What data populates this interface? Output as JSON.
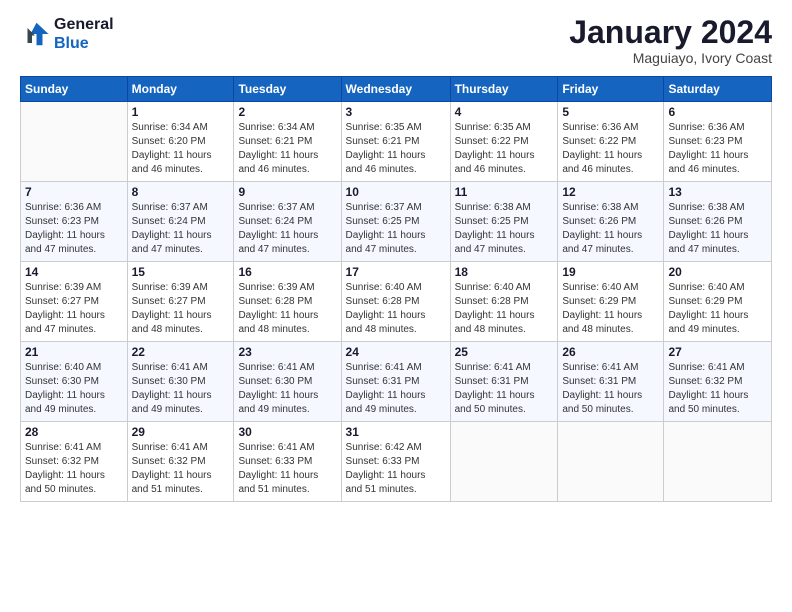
{
  "logo": {
    "line1": "General",
    "line2": "Blue"
  },
  "title": "January 2024",
  "subtitle": "Maguiayo, Ivory Coast",
  "days": [
    "Sunday",
    "Monday",
    "Tuesday",
    "Wednesday",
    "Thursday",
    "Friday",
    "Saturday"
  ],
  "weeks": [
    [
      {
        "day": "",
        "content": ""
      },
      {
        "day": "1",
        "content": "Sunrise: 6:34 AM\nSunset: 6:20 PM\nDaylight: 11 hours\nand 46 minutes."
      },
      {
        "day": "2",
        "content": "Sunrise: 6:34 AM\nSunset: 6:21 PM\nDaylight: 11 hours\nand 46 minutes."
      },
      {
        "day": "3",
        "content": "Sunrise: 6:35 AM\nSunset: 6:21 PM\nDaylight: 11 hours\nand 46 minutes."
      },
      {
        "day": "4",
        "content": "Sunrise: 6:35 AM\nSunset: 6:22 PM\nDaylight: 11 hours\nand 46 minutes."
      },
      {
        "day": "5",
        "content": "Sunrise: 6:36 AM\nSunset: 6:22 PM\nDaylight: 11 hours\nand 46 minutes."
      },
      {
        "day": "6",
        "content": "Sunrise: 6:36 AM\nSunset: 6:23 PM\nDaylight: 11 hours\nand 46 minutes."
      }
    ],
    [
      {
        "day": "7",
        "content": "Sunrise: 6:36 AM\nSunset: 6:23 PM\nDaylight: 11 hours\nand 47 minutes."
      },
      {
        "day": "8",
        "content": "Sunrise: 6:37 AM\nSunset: 6:24 PM\nDaylight: 11 hours\nand 47 minutes."
      },
      {
        "day": "9",
        "content": "Sunrise: 6:37 AM\nSunset: 6:24 PM\nDaylight: 11 hours\nand 47 minutes."
      },
      {
        "day": "10",
        "content": "Sunrise: 6:37 AM\nSunset: 6:25 PM\nDaylight: 11 hours\nand 47 minutes."
      },
      {
        "day": "11",
        "content": "Sunrise: 6:38 AM\nSunset: 6:25 PM\nDaylight: 11 hours\nand 47 minutes."
      },
      {
        "day": "12",
        "content": "Sunrise: 6:38 AM\nSunset: 6:26 PM\nDaylight: 11 hours\nand 47 minutes."
      },
      {
        "day": "13",
        "content": "Sunrise: 6:38 AM\nSunset: 6:26 PM\nDaylight: 11 hours\nand 47 minutes."
      }
    ],
    [
      {
        "day": "14",
        "content": "Sunrise: 6:39 AM\nSunset: 6:27 PM\nDaylight: 11 hours\nand 47 minutes."
      },
      {
        "day": "15",
        "content": "Sunrise: 6:39 AM\nSunset: 6:27 PM\nDaylight: 11 hours\nand 48 minutes."
      },
      {
        "day": "16",
        "content": "Sunrise: 6:39 AM\nSunset: 6:28 PM\nDaylight: 11 hours\nand 48 minutes."
      },
      {
        "day": "17",
        "content": "Sunrise: 6:40 AM\nSunset: 6:28 PM\nDaylight: 11 hours\nand 48 minutes."
      },
      {
        "day": "18",
        "content": "Sunrise: 6:40 AM\nSunset: 6:28 PM\nDaylight: 11 hours\nand 48 minutes."
      },
      {
        "day": "19",
        "content": "Sunrise: 6:40 AM\nSunset: 6:29 PM\nDaylight: 11 hours\nand 48 minutes."
      },
      {
        "day": "20",
        "content": "Sunrise: 6:40 AM\nSunset: 6:29 PM\nDaylight: 11 hours\nand 49 minutes."
      }
    ],
    [
      {
        "day": "21",
        "content": "Sunrise: 6:40 AM\nSunset: 6:30 PM\nDaylight: 11 hours\nand 49 minutes."
      },
      {
        "day": "22",
        "content": "Sunrise: 6:41 AM\nSunset: 6:30 PM\nDaylight: 11 hours\nand 49 minutes."
      },
      {
        "day": "23",
        "content": "Sunrise: 6:41 AM\nSunset: 6:30 PM\nDaylight: 11 hours\nand 49 minutes."
      },
      {
        "day": "24",
        "content": "Sunrise: 6:41 AM\nSunset: 6:31 PM\nDaylight: 11 hours\nand 49 minutes."
      },
      {
        "day": "25",
        "content": "Sunrise: 6:41 AM\nSunset: 6:31 PM\nDaylight: 11 hours\nand 50 minutes."
      },
      {
        "day": "26",
        "content": "Sunrise: 6:41 AM\nSunset: 6:31 PM\nDaylight: 11 hours\nand 50 minutes."
      },
      {
        "day": "27",
        "content": "Sunrise: 6:41 AM\nSunset: 6:32 PM\nDaylight: 11 hours\nand 50 minutes."
      }
    ],
    [
      {
        "day": "28",
        "content": "Sunrise: 6:41 AM\nSunset: 6:32 PM\nDaylight: 11 hours\nand 50 minutes."
      },
      {
        "day": "29",
        "content": "Sunrise: 6:41 AM\nSunset: 6:32 PM\nDaylight: 11 hours\nand 51 minutes."
      },
      {
        "day": "30",
        "content": "Sunrise: 6:41 AM\nSunset: 6:33 PM\nDaylight: 11 hours\nand 51 minutes."
      },
      {
        "day": "31",
        "content": "Sunrise: 6:42 AM\nSunset: 6:33 PM\nDaylight: 11 hours\nand 51 minutes."
      },
      {
        "day": "",
        "content": ""
      },
      {
        "day": "",
        "content": ""
      },
      {
        "day": "",
        "content": ""
      }
    ]
  ]
}
